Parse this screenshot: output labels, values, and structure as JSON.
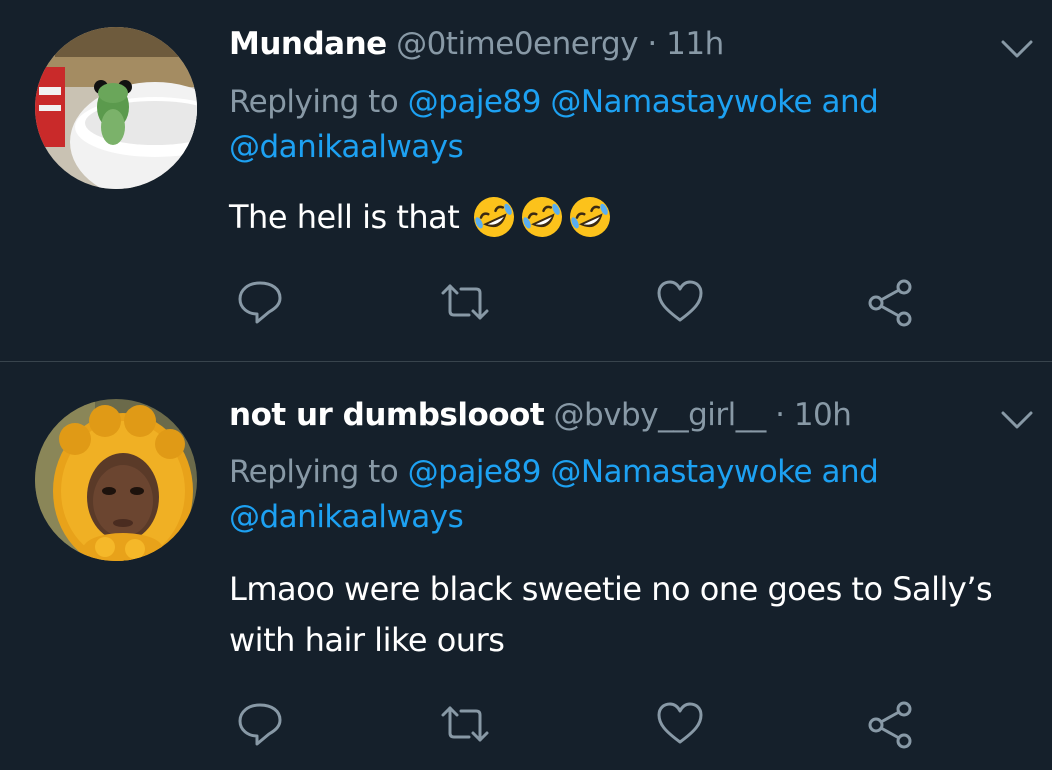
{
  "tweets": [
    {
      "name": "Mundane",
      "handle": "@0time0energy",
      "separator": "·",
      "time": "11h",
      "replying_prefix": "Replying to",
      "mentions": [
        "@paje89",
        "@Namastaywoke"
      ],
      "and_word": "and",
      "last_mention": "@danikaalways",
      "text": "The hell is that",
      "emoji": [
        "rolling-on-floor-laughing",
        "rolling-on-floor-laughing",
        "rolling-on-floor-laughing"
      ],
      "avatar": "frog-on-cup"
    },
    {
      "name": "not ur dumbslooot",
      "handle": "@bvby__girl__",
      "separator": "·",
      "time": "10h",
      "replying_prefix": "Replying to",
      "mentions": [
        "@paje89",
        "@Namastaywoke"
      ],
      "and_word": "and",
      "last_mention": "@danikaalways",
      "text_line1": "Lmaoo were black sweetie no one goes to Sally’s",
      "text_line2": "with hair like ours",
      "avatar": "person-in-orange-hood"
    }
  ],
  "actions": [
    "reply-icon",
    "retweet-icon",
    "like-icon",
    "share-icon"
  ],
  "colors": {
    "background": "#15202b",
    "text": "#ffffff",
    "secondary": "#8899a6",
    "link": "#1da1f2",
    "divider": "#38444d"
  }
}
